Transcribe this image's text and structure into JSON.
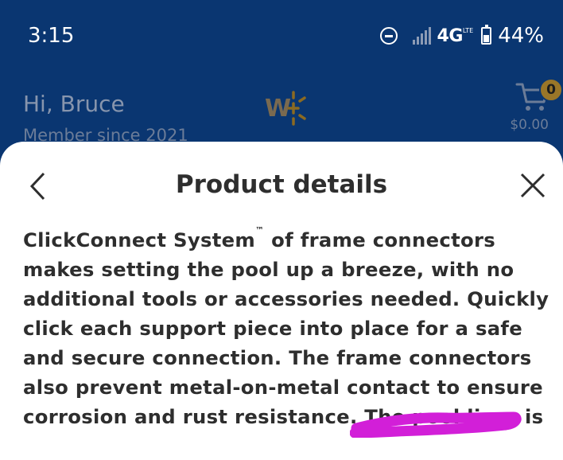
{
  "status_bar": {
    "time": "3:15",
    "network": "4G",
    "network_sub": "LTE",
    "battery_percent": "44%",
    "battery_level": 0.44,
    "icons": [
      "do-not-disturb-icon",
      "signal-icon",
      "battery-icon"
    ]
  },
  "header": {
    "greeting": "Hi, Bruce",
    "member_since": "Member since 2021",
    "logo": "walmart-plus-logo",
    "cart": {
      "count": "0",
      "total": "$0.00"
    }
  },
  "sheet": {
    "title": "Product details",
    "back_icon": "chevron-left-icon",
    "close_icon": "close-icon",
    "description_lines": [
      "ClickConnect System",
      "makes setting the pool up a breeze, with no",
      "additional tools or accessories needed. Quickly",
      "click each support piece into place for a safe",
      "and secure connection. The frame connectors",
      "also prevent metal-on-metal contact to ensure",
      "corrosion and rust resistance. The pool liner is"
    ],
    "trademark": "™",
    "line1_rest": " of frame connectors"
  },
  "colors": {
    "header_bg": "#0a3671",
    "sheet_bg": "#ffffff",
    "text": "#2e2e2e",
    "badge": "#9a7628",
    "scribble": "#d21fd8"
  }
}
